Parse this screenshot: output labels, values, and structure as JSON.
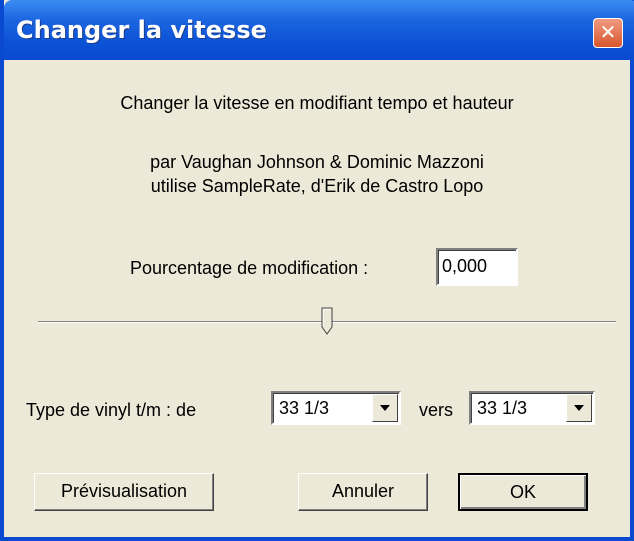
{
  "window": {
    "title": "Changer la vitesse",
    "close_symbol": "✕"
  },
  "content": {
    "description": "Changer la vitesse en modifiant tempo et hauteur",
    "credits_line1": "par Vaughan Johnson & Dominic Mazzoni",
    "credits_line2": "utilise SampleRate, d'Erik de Castro Lopo"
  },
  "percent": {
    "label": "Pourcentage de modification :",
    "value": "0,000"
  },
  "slider": {
    "value_percent": 0
  },
  "vinyl": {
    "label": "Type de vinyl t/m : de",
    "from_value": "33 1/3",
    "to_label": "vers",
    "to_value": "33 1/3"
  },
  "buttons": {
    "preview": "Prévisualisation",
    "cancel": "Annuler",
    "ok": "OK"
  },
  "icons": {
    "close": "close-icon",
    "dropdown": "chevron-down-icon"
  }
}
